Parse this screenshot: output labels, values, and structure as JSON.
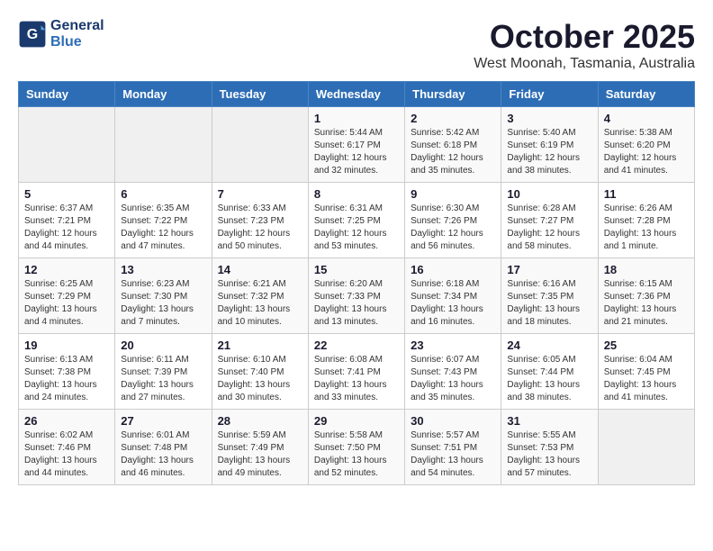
{
  "header": {
    "logo_line1": "General",
    "logo_line2": "Blue",
    "month_title": "October 2025",
    "subtitle": "West Moonah, Tasmania, Australia"
  },
  "days_of_week": [
    "Sunday",
    "Monday",
    "Tuesday",
    "Wednesday",
    "Thursday",
    "Friday",
    "Saturday"
  ],
  "weeks": [
    [
      {
        "day": "",
        "info": ""
      },
      {
        "day": "",
        "info": ""
      },
      {
        "day": "",
        "info": ""
      },
      {
        "day": "1",
        "info": "Sunrise: 5:44 AM\nSunset: 6:17 PM\nDaylight: 12 hours\nand 32 minutes."
      },
      {
        "day": "2",
        "info": "Sunrise: 5:42 AM\nSunset: 6:18 PM\nDaylight: 12 hours\nand 35 minutes."
      },
      {
        "day": "3",
        "info": "Sunrise: 5:40 AM\nSunset: 6:19 PM\nDaylight: 12 hours\nand 38 minutes."
      },
      {
        "day": "4",
        "info": "Sunrise: 5:38 AM\nSunset: 6:20 PM\nDaylight: 12 hours\nand 41 minutes."
      }
    ],
    [
      {
        "day": "5",
        "info": "Sunrise: 6:37 AM\nSunset: 7:21 PM\nDaylight: 12 hours\nand 44 minutes."
      },
      {
        "day": "6",
        "info": "Sunrise: 6:35 AM\nSunset: 7:22 PM\nDaylight: 12 hours\nand 47 minutes."
      },
      {
        "day": "7",
        "info": "Sunrise: 6:33 AM\nSunset: 7:23 PM\nDaylight: 12 hours\nand 50 minutes."
      },
      {
        "day": "8",
        "info": "Sunrise: 6:31 AM\nSunset: 7:25 PM\nDaylight: 12 hours\nand 53 minutes."
      },
      {
        "day": "9",
        "info": "Sunrise: 6:30 AM\nSunset: 7:26 PM\nDaylight: 12 hours\nand 56 minutes."
      },
      {
        "day": "10",
        "info": "Sunrise: 6:28 AM\nSunset: 7:27 PM\nDaylight: 12 hours\nand 58 minutes."
      },
      {
        "day": "11",
        "info": "Sunrise: 6:26 AM\nSunset: 7:28 PM\nDaylight: 13 hours\nand 1 minute."
      }
    ],
    [
      {
        "day": "12",
        "info": "Sunrise: 6:25 AM\nSunset: 7:29 PM\nDaylight: 13 hours\nand 4 minutes."
      },
      {
        "day": "13",
        "info": "Sunrise: 6:23 AM\nSunset: 7:30 PM\nDaylight: 13 hours\nand 7 minutes."
      },
      {
        "day": "14",
        "info": "Sunrise: 6:21 AM\nSunset: 7:32 PM\nDaylight: 13 hours\nand 10 minutes."
      },
      {
        "day": "15",
        "info": "Sunrise: 6:20 AM\nSunset: 7:33 PM\nDaylight: 13 hours\nand 13 minutes."
      },
      {
        "day": "16",
        "info": "Sunrise: 6:18 AM\nSunset: 7:34 PM\nDaylight: 13 hours\nand 16 minutes."
      },
      {
        "day": "17",
        "info": "Sunrise: 6:16 AM\nSunset: 7:35 PM\nDaylight: 13 hours\nand 18 minutes."
      },
      {
        "day": "18",
        "info": "Sunrise: 6:15 AM\nSunset: 7:36 PM\nDaylight: 13 hours\nand 21 minutes."
      }
    ],
    [
      {
        "day": "19",
        "info": "Sunrise: 6:13 AM\nSunset: 7:38 PM\nDaylight: 13 hours\nand 24 minutes."
      },
      {
        "day": "20",
        "info": "Sunrise: 6:11 AM\nSunset: 7:39 PM\nDaylight: 13 hours\nand 27 minutes."
      },
      {
        "day": "21",
        "info": "Sunrise: 6:10 AM\nSunset: 7:40 PM\nDaylight: 13 hours\nand 30 minutes."
      },
      {
        "day": "22",
        "info": "Sunrise: 6:08 AM\nSunset: 7:41 PM\nDaylight: 13 hours\nand 33 minutes."
      },
      {
        "day": "23",
        "info": "Sunrise: 6:07 AM\nSunset: 7:43 PM\nDaylight: 13 hours\nand 35 minutes."
      },
      {
        "day": "24",
        "info": "Sunrise: 6:05 AM\nSunset: 7:44 PM\nDaylight: 13 hours\nand 38 minutes."
      },
      {
        "day": "25",
        "info": "Sunrise: 6:04 AM\nSunset: 7:45 PM\nDaylight: 13 hours\nand 41 minutes."
      }
    ],
    [
      {
        "day": "26",
        "info": "Sunrise: 6:02 AM\nSunset: 7:46 PM\nDaylight: 13 hours\nand 44 minutes."
      },
      {
        "day": "27",
        "info": "Sunrise: 6:01 AM\nSunset: 7:48 PM\nDaylight: 13 hours\nand 46 minutes."
      },
      {
        "day": "28",
        "info": "Sunrise: 5:59 AM\nSunset: 7:49 PM\nDaylight: 13 hours\nand 49 minutes."
      },
      {
        "day": "29",
        "info": "Sunrise: 5:58 AM\nSunset: 7:50 PM\nDaylight: 13 hours\nand 52 minutes."
      },
      {
        "day": "30",
        "info": "Sunrise: 5:57 AM\nSunset: 7:51 PM\nDaylight: 13 hours\nand 54 minutes."
      },
      {
        "day": "31",
        "info": "Sunrise: 5:55 AM\nSunset: 7:53 PM\nDaylight: 13 hours\nand 57 minutes."
      },
      {
        "day": "",
        "info": ""
      }
    ]
  ]
}
